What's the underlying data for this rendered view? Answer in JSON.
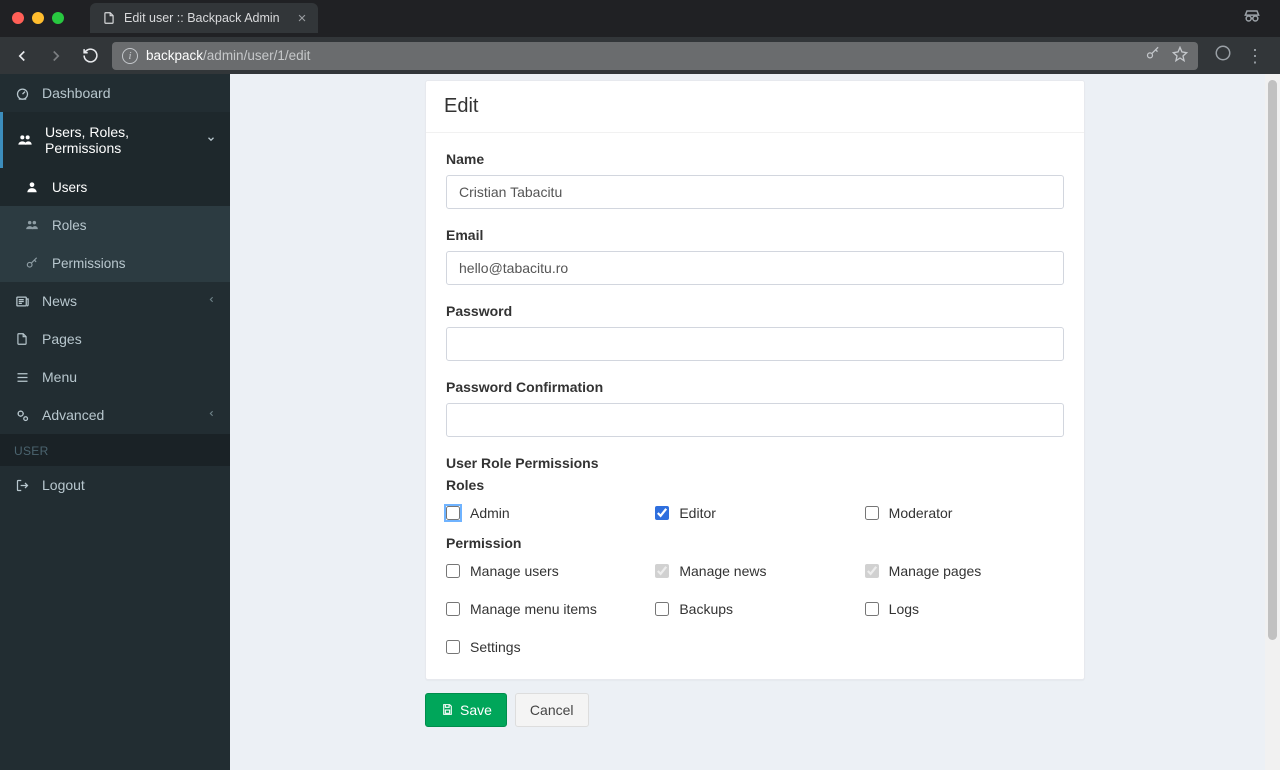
{
  "browser": {
    "tab_title": "Edit user :: Backpack Admin",
    "url_host": "backpack",
    "url_path": "/admin/user/1/edit"
  },
  "sidebar": {
    "dashboard": "Dashboard",
    "group_urp": "Users, Roles, Permissions",
    "users": "Users",
    "roles": "Roles",
    "permissions": "Permissions",
    "news": "News",
    "pages": "Pages",
    "menu": "Menu",
    "advanced": "Advanced",
    "user_header": "USER",
    "logout": "Logout"
  },
  "page": {
    "heading": "Edit",
    "fields": {
      "name_label": "Name",
      "name_value": "Cristian Tabacitu",
      "email_label": "Email",
      "email_value": "hello@tabacitu.ro",
      "password_label": "Password",
      "password_confirmation_label": "Password Confirmation"
    },
    "role_perm_heading": "User Role Permissions",
    "roles_heading": "Roles",
    "roles": [
      {
        "label": "Admin",
        "checked": false,
        "focused": true
      },
      {
        "label": "Editor",
        "checked": true
      },
      {
        "label": "Moderator",
        "checked": false
      }
    ],
    "permission_heading": "Permission",
    "permissions": [
      {
        "label": "Manage users",
        "checked": false
      },
      {
        "label": "Manage news",
        "checked": true,
        "disabled": true
      },
      {
        "label": "Manage pages",
        "checked": true,
        "disabled": true
      },
      {
        "label": "Manage menu items",
        "checked": false
      },
      {
        "label": "Backups",
        "checked": false
      },
      {
        "label": "Logs",
        "checked": false
      },
      {
        "label": "Settings",
        "checked": false
      }
    ],
    "actions": {
      "save_label": "Save",
      "cancel_label": "Cancel"
    }
  }
}
